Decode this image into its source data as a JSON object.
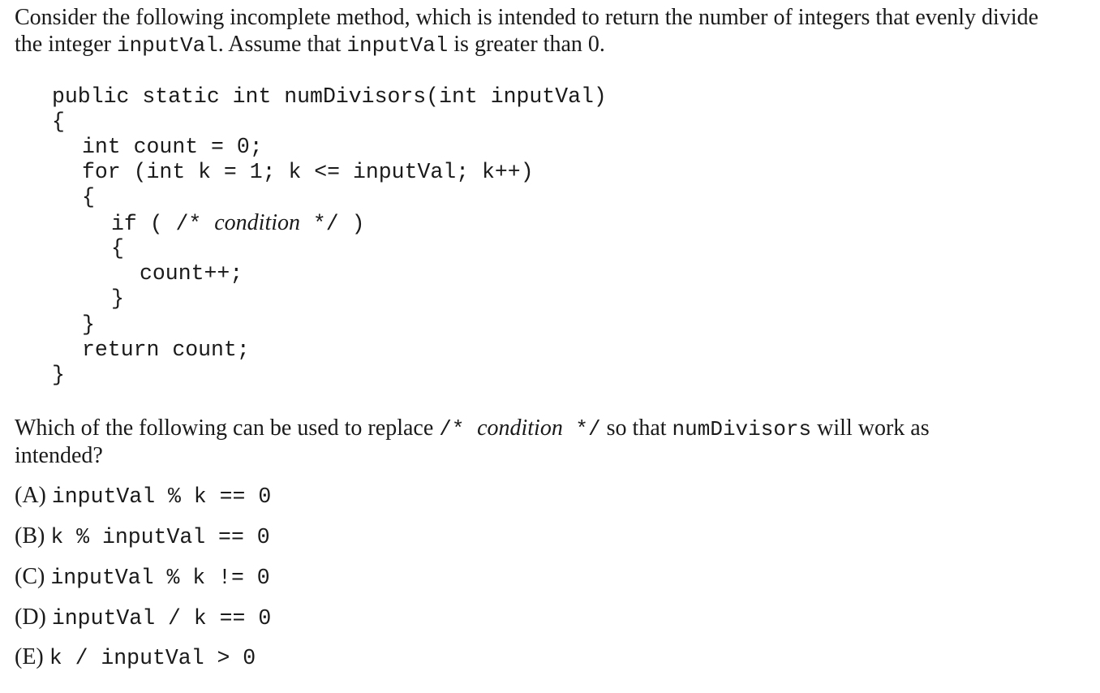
{
  "intro": {
    "line1": "Consider the following incomplete method, which is intended to return the number of integers that evenly divide",
    "line2_a": "the integer ",
    "line2_code1": "inputVal",
    "line2_b": ". Assume that ",
    "line2_code2": "inputVal",
    "line2_c": " is greater than 0."
  },
  "code": {
    "l1": "public static int numDivisors(int inputVal)",
    "l2": "{",
    "l3": "int count = 0;",
    "l4": "for (int k = 1; k <= inputVal; k++)",
    "l5": "{",
    "l6_a": "if ( /* ",
    "l6_cond": "condition",
    "l6_b": " */ )",
    "l7": "{",
    "l8": "count++;",
    "l9": "}",
    "l10": "}",
    "l11": "return count;",
    "l12": "}"
  },
  "question": {
    "a": "Which of the following can be used to replace ",
    "code_open": "/* ",
    "cond": "condition",
    "code_close": " */",
    "b": " so that ",
    "code_method": "numDivisors",
    "c": " will work as",
    "line2": "intended?"
  },
  "choices": [
    {
      "label": "(A) ",
      "code": "inputVal % k == 0"
    },
    {
      "label": "(B) ",
      "code": "k % inputVal == 0"
    },
    {
      "label": "(C) ",
      "code": "inputVal % k != 0"
    },
    {
      "label": "(D) ",
      "code": "inputVal / k == 0"
    },
    {
      "label": "(E) ",
      "code": "k / inputVal > 0"
    }
  ]
}
